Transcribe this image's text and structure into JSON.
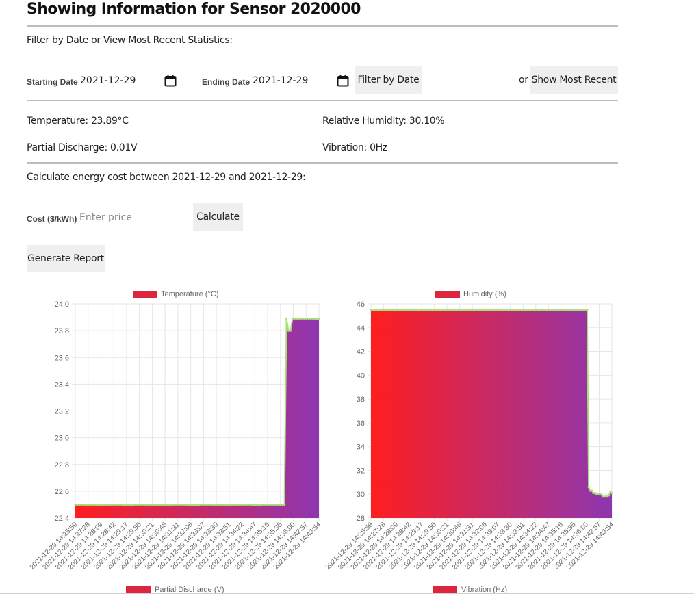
{
  "header": {
    "title": "Showing Information for Sensor 2020000"
  },
  "filter": {
    "heading": "Filter by Date or View Most Recent Statistics:",
    "start_label": "Starting Date",
    "start_value": "2021-12-29",
    "end_label": "Ending Date",
    "end_value": "2021-12-29",
    "filter_button": "Filter by Date",
    "or_text": "or",
    "recent_button": "Show Most Recent"
  },
  "stats": {
    "temperature": "Temperature: 23.89°C",
    "humidity": "Relative Humidity: 30.10%",
    "discharge": "Partial Discharge: 0.01V",
    "vibration": "Vibration: 0Hz"
  },
  "energy": {
    "heading": "Calculate energy cost between 2021-12-29 and 2021-12-29:",
    "cost_label": "Cost ($/kWh)",
    "cost_placeholder": "Enter price",
    "calculate_button": "Calculate"
  },
  "report": {
    "button": "Generate Report"
  },
  "colors": {
    "gradient_start": "#ff1e1e",
    "gradient_end": "#8e36b0",
    "legend": "#dc2640",
    "line": "#a9e07a"
  },
  "chart_data": [
    {
      "type": "area",
      "legend_top": "Temperature (°C)",
      "legend_bottom": "Partial Discharge (V)",
      "x_labels": [
        "2021-12-29 14:25:59",
        "2021-12-29 14:27:28",
        "2021-12-29 14:28:09",
        "2021-12-29 14:28:42",
        "2021-12-29 14:29:17",
        "2021-12-29 14:29:56",
        "2021-12-29 14:30:21",
        "2021-12-29 14:30:48",
        "2021-12-29 14:31:31",
        "2021-12-29 14:32:06",
        "2021-12-29 14:33:07",
        "2021-12-29 14:33:30",
        "2021-12-29 14:33:51",
        "2021-12-29 14:34:22",
        "2021-12-29 14:34:47",
        "2021-12-29 14:35:16",
        "2021-12-29 14:35:35",
        "2021-12-29 14:36:00",
        "2021-12-29 14:42:57",
        "2021-12-29 14:43:54"
      ],
      "values": [
        22.5,
        22.5,
        22.5,
        22.5,
        22.5,
        22.5,
        22.5,
        22.5,
        22.5,
        22.5,
        22.5,
        22.5,
        22.5,
        22.5,
        22.5,
        22.5,
        22.5,
        22.5,
        22.5,
        22.5,
        22.5,
        22.5,
        22.5,
        22.5,
        22.5,
        22.5,
        22.5,
        22.5,
        22.5,
        22.5,
        22.5,
        22.5,
        22.5,
        22.5,
        22.5,
        22.5,
        22.5,
        22.5,
        22.5,
        22.5,
        22.5,
        22.5,
        22.5,
        22.5,
        22.5,
        22.5,
        22.5,
        22.5,
        22.5,
        22.5,
        22.5,
        22.5,
        22.5,
        22.5,
        22.5,
        22.5,
        22.5,
        22.5,
        22.5,
        22.5,
        22.5,
        22.5,
        22.5,
        22.5,
        22.5,
        22.5,
        22.5,
        22.5,
        22.5,
        22.5,
        22.5,
        22.5,
        22.5,
        22.5,
        22.5,
        22.5,
        22.5,
        22.5,
        22.5,
        22.5,
        22.5,
        22.5,
        22.5,
        22.5,
        22.5,
        22.5,
        22.5,
        22.5,
        22.5,
        22.5,
        22.5,
        22.5,
        22.5,
        22.5,
        22.5,
        22.5,
        22.5,
        22.5,
        22.5,
        22.5,
        22.5,
        22.5,
        22.5,
        22.5,
        23.89,
        23.8,
        23.8,
        23.89,
        23.89,
        23.89,
        23.89,
        23.89,
        23.89,
        23.89,
        23.89,
        23.89,
        23.89,
        23.89,
        23.89,
        23.89,
        23.89
      ],
      "ylim": [
        22.4,
        24.0
      ],
      "y_ticks": [
        22.4,
        22.6,
        22.8,
        23.0,
        23.2,
        23.4,
        23.6,
        23.8,
        24.0
      ],
      "grid": true
    },
    {
      "type": "area",
      "legend_top": "Humidity (%)",
      "legend_bottom": "Vibration (Hz)",
      "x_labels": [
        "2021-12-29 14:25:59",
        "2021-12-29 14:27:28",
        "2021-12-29 14:28:09",
        "2021-12-29 14:28:42",
        "2021-12-29 14:29:17",
        "2021-12-29 14:29:56",
        "2021-12-29 14:30:21",
        "2021-12-29 14:30:48",
        "2021-12-29 14:31:31",
        "2021-12-29 14:32:06",
        "2021-12-29 14:33:07",
        "2021-12-29 14:33:30",
        "2021-12-29 14:33:51",
        "2021-12-29 14:34:22",
        "2021-12-29 14:34:47",
        "2021-12-29 14:35:16",
        "2021-12-29 14:35:35",
        "2021-12-29 14:36:00",
        "2021-12-29 14:42:57",
        "2021-12-29 14:43:54"
      ],
      "values": [
        45.5,
        45.5,
        45.5,
        45.5,
        45.5,
        45.5,
        45.5,
        45.5,
        45.5,
        45.5,
        45.5,
        45.5,
        45.5,
        45.5,
        45.5,
        45.5,
        45.5,
        45.5,
        45.5,
        45.5,
        45.5,
        45.5,
        45.5,
        45.5,
        45.5,
        45.5,
        45.5,
        45.5,
        45.5,
        45.5,
        45.5,
        45.5,
        45.5,
        45.5,
        45.5,
        45.5,
        45.5,
        45.5,
        45.5,
        45.5,
        45.5,
        45.5,
        45.5,
        45.5,
        45.5,
        45.5,
        45.5,
        45.5,
        45.5,
        45.5,
        45.5,
        45.5,
        45.5,
        45.5,
        45.5,
        45.5,
        45.5,
        45.5,
        45.5,
        45.5,
        45.5,
        45.5,
        45.5,
        45.5,
        45.5,
        45.5,
        45.5,
        45.5,
        45.5,
        45.5,
        45.5,
        45.5,
        45.5,
        45.5,
        45.5,
        45.5,
        45.5,
        45.5,
        45.5,
        45.5,
        45.5,
        45.5,
        45.5,
        45.5,
        45.5,
        45.5,
        45.5,
        45.5,
        45.5,
        45.5,
        45.5,
        45.5,
        45.5,
        45.5,
        45.5,
        45.5,
        45.5,
        45.5,
        45.5,
        45.5,
        45.5,
        45.5,
        45.5,
        45.5,
        45.5,
        45.5,
        45.5,
        45.5,
        45.5,
        45.5,
        45.5,
        45.5,
        45.5,
        45.5,
        45.5,
        45.5,
        45.5,
        45.5,
        45.5,
        45.5,
        45.5,
        45.5,
        45.5,
        45.5,
        45.5,
        45.5,
        45.5,
        45.5,
        45.5,
        45.5,
        45.5,
        45.5,
        45.5,
        45.5,
        45.5,
        45.5,
        45.5,
        45.5,
        45.5,
        45.5,
        45.5,
        30.6,
        30.3,
        30.3,
        30.1,
        30.1,
        30.0,
        30.0,
        30.0,
        30.0,
        29.8,
        29.8,
        29.8,
        29.8,
        29.9,
        30.2,
        30.1
      ],
      "ylim": [
        28,
        46
      ],
      "y_ticks": [
        28,
        30,
        32,
        34,
        36,
        38,
        40,
        42,
        44,
        46
      ],
      "grid": true
    }
  ]
}
